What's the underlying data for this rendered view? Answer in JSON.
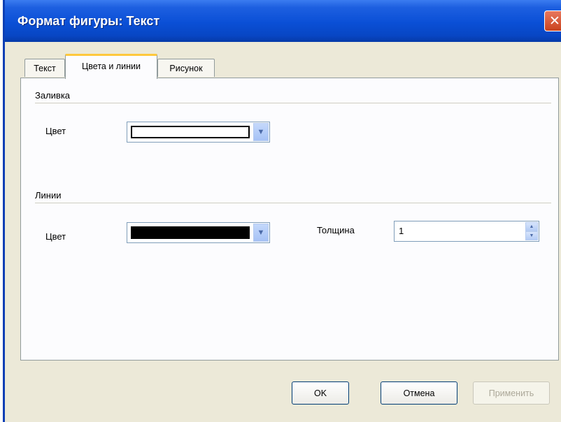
{
  "window": {
    "title": "Формат фигуры: Текст",
    "close_symbol": "✕"
  },
  "tabs": [
    {
      "label": "Текст",
      "active": false
    },
    {
      "label": "Цвета и линии",
      "active": true
    },
    {
      "label": "Рисунок",
      "active": false
    }
  ],
  "fill": {
    "section_label": "Заливка",
    "color_label": "Цвет",
    "color_value": "#ffffff"
  },
  "lines": {
    "section_label": "Линии",
    "color_label": "Цвет",
    "color_value": "#000000",
    "thickness_label": "Толщина",
    "thickness_value": "1"
  },
  "buttons": {
    "ok": "OK",
    "cancel": "Отмена",
    "apply": "Применить",
    "apply_enabled": false
  },
  "icons": {
    "dropdown": "chevron-down-icon",
    "spin_up": "arrow-up-icon",
    "spin_down": "arrow-down-icon",
    "close": "close-icon"
  }
}
